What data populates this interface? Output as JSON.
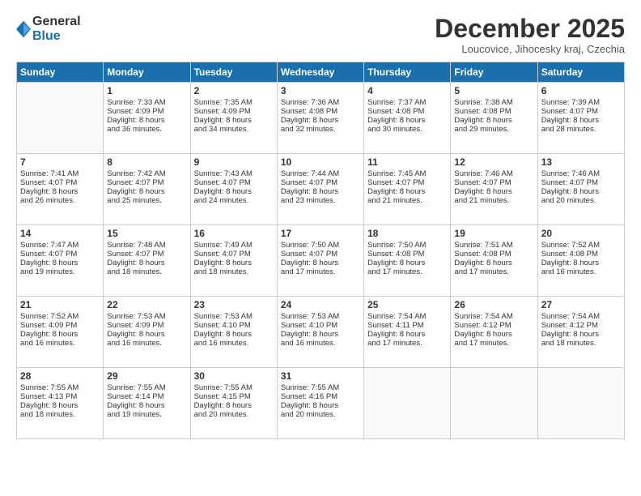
{
  "logo": {
    "general": "General",
    "blue": "Blue"
  },
  "title": "December 2025",
  "subtitle": "Loucovice, Jihocesky kraj, Czechia",
  "headers": [
    "Sunday",
    "Monday",
    "Tuesday",
    "Wednesday",
    "Thursday",
    "Friday",
    "Saturday"
  ],
  "weeks": [
    [
      {
        "day": "",
        "lines": []
      },
      {
        "day": "1",
        "lines": [
          "Sunrise: 7:33 AM",
          "Sunset: 4:09 PM",
          "Daylight: 8 hours",
          "and 36 minutes."
        ]
      },
      {
        "day": "2",
        "lines": [
          "Sunrise: 7:35 AM",
          "Sunset: 4:09 PM",
          "Daylight: 8 hours",
          "and 34 minutes."
        ]
      },
      {
        "day": "3",
        "lines": [
          "Sunrise: 7:36 AM",
          "Sunset: 4:08 PM",
          "Daylight: 8 hours",
          "and 32 minutes."
        ]
      },
      {
        "day": "4",
        "lines": [
          "Sunrise: 7:37 AM",
          "Sunset: 4:08 PM",
          "Daylight: 8 hours",
          "and 30 minutes."
        ]
      },
      {
        "day": "5",
        "lines": [
          "Sunrise: 7:38 AM",
          "Sunset: 4:08 PM",
          "Daylight: 8 hours",
          "and 29 minutes."
        ]
      },
      {
        "day": "6",
        "lines": [
          "Sunrise: 7:39 AM",
          "Sunset: 4:07 PM",
          "Daylight: 8 hours",
          "and 28 minutes."
        ]
      }
    ],
    [
      {
        "day": "7",
        "lines": [
          "Sunrise: 7:41 AM",
          "Sunset: 4:07 PM",
          "Daylight: 8 hours",
          "and 26 minutes."
        ]
      },
      {
        "day": "8",
        "lines": [
          "Sunrise: 7:42 AM",
          "Sunset: 4:07 PM",
          "Daylight: 8 hours",
          "and 25 minutes."
        ]
      },
      {
        "day": "9",
        "lines": [
          "Sunrise: 7:43 AM",
          "Sunset: 4:07 PM",
          "Daylight: 8 hours",
          "and 24 minutes."
        ]
      },
      {
        "day": "10",
        "lines": [
          "Sunrise: 7:44 AM",
          "Sunset: 4:07 PM",
          "Daylight: 8 hours",
          "and 23 minutes."
        ]
      },
      {
        "day": "11",
        "lines": [
          "Sunrise: 7:45 AM",
          "Sunset: 4:07 PM",
          "Daylight: 8 hours",
          "and 21 minutes."
        ]
      },
      {
        "day": "12",
        "lines": [
          "Sunrise: 7:46 AM",
          "Sunset: 4:07 PM",
          "Daylight: 8 hours",
          "and 21 minutes."
        ]
      },
      {
        "day": "13",
        "lines": [
          "Sunrise: 7:46 AM",
          "Sunset: 4:07 PM",
          "Daylight: 8 hours",
          "and 20 minutes."
        ]
      }
    ],
    [
      {
        "day": "14",
        "lines": [
          "Sunrise: 7:47 AM",
          "Sunset: 4:07 PM",
          "Daylight: 8 hours",
          "and 19 minutes."
        ]
      },
      {
        "day": "15",
        "lines": [
          "Sunrise: 7:48 AM",
          "Sunset: 4:07 PM",
          "Daylight: 8 hours",
          "and 18 minutes."
        ]
      },
      {
        "day": "16",
        "lines": [
          "Sunrise: 7:49 AM",
          "Sunset: 4:07 PM",
          "Daylight: 8 hours",
          "and 18 minutes."
        ]
      },
      {
        "day": "17",
        "lines": [
          "Sunrise: 7:50 AM",
          "Sunset: 4:07 PM",
          "Daylight: 8 hours",
          "and 17 minutes."
        ]
      },
      {
        "day": "18",
        "lines": [
          "Sunrise: 7:50 AM",
          "Sunset: 4:08 PM",
          "Daylight: 8 hours",
          "and 17 minutes."
        ]
      },
      {
        "day": "19",
        "lines": [
          "Sunrise: 7:51 AM",
          "Sunset: 4:08 PM",
          "Daylight: 8 hours",
          "and 17 minutes."
        ]
      },
      {
        "day": "20",
        "lines": [
          "Sunrise: 7:52 AM",
          "Sunset: 4:08 PM",
          "Daylight: 8 hours",
          "and 16 minutes."
        ]
      }
    ],
    [
      {
        "day": "21",
        "lines": [
          "Sunrise: 7:52 AM",
          "Sunset: 4:09 PM",
          "Daylight: 8 hours",
          "and 16 minutes."
        ]
      },
      {
        "day": "22",
        "lines": [
          "Sunrise: 7:53 AM",
          "Sunset: 4:09 PM",
          "Daylight: 8 hours",
          "and 16 minutes."
        ]
      },
      {
        "day": "23",
        "lines": [
          "Sunrise: 7:53 AM",
          "Sunset: 4:10 PM",
          "Daylight: 8 hours",
          "and 16 minutes."
        ]
      },
      {
        "day": "24",
        "lines": [
          "Sunrise: 7:53 AM",
          "Sunset: 4:10 PM",
          "Daylight: 8 hours",
          "and 16 minutes."
        ]
      },
      {
        "day": "25",
        "lines": [
          "Sunrise: 7:54 AM",
          "Sunset: 4:11 PM",
          "Daylight: 8 hours",
          "and 17 minutes."
        ]
      },
      {
        "day": "26",
        "lines": [
          "Sunrise: 7:54 AM",
          "Sunset: 4:12 PM",
          "Daylight: 8 hours",
          "and 17 minutes."
        ]
      },
      {
        "day": "27",
        "lines": [
          "Sunrise: 7:54 AM",
          "Sunset: 4:12 PM",
          "Daylight: 8 hours",
          "and 18 minutes."
        ]
      }
    ],
    [
      {
        "day": "28",
        "lines": [
          "Sunrise: 7:55 AM",
          "Sunset: 4:13 PM",
          "Daylight: 8 hours",
          "and 18 minutes."
        ]
      },
      {
        "day": "29",
        "lines": [
          "Sunrise: 7:55 AM",
          "Sunset: 4:14 PM",
          "Daylight: 8 hours",
          "and 19 minutes."
        ]
      },
      {
        "day": "30",
        "lines": [
          "Sunrise: 7:55 AM",
          "Sunset: 4:15 PM",
          "Daylight: 8 hours",
          "and 20 minutes."
        ]
      },
      {
        "day": "31",
        "lines": [
          "Sunrise: 7:55 AM",
          "Sunset: 4:16 PM",
          "Daylight: 8 hours",
          "and 20 minutes."
        ]
      },
      {
        "day": "",
        "lines": []
      },
      {
        "day": "",
        "lines": []
      },
      {
        "day": "",
        "lines": []
      }
    ]
  ]
}
